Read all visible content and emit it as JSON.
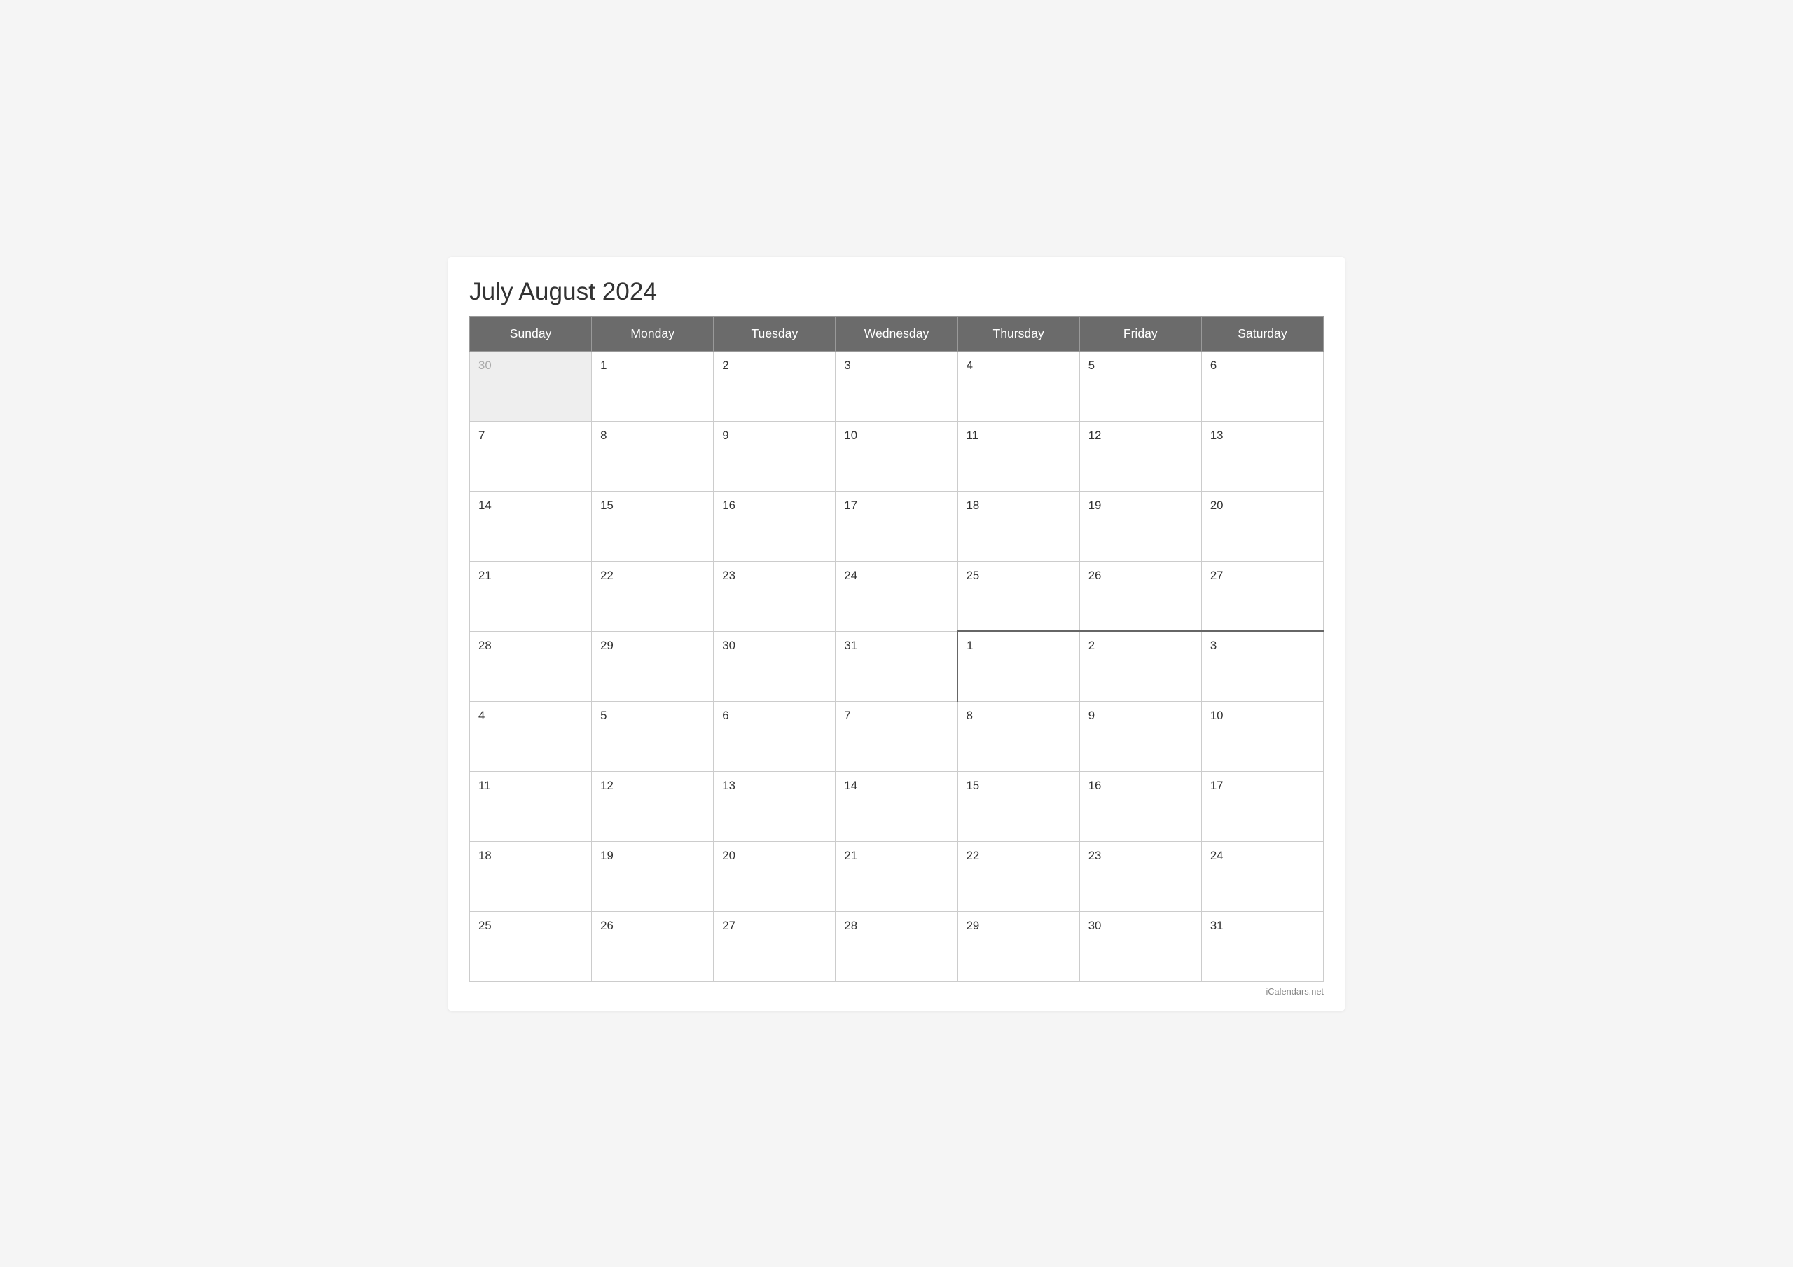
{
  "title": "July August 2024",
  "header": {
    "days": [
      "Sunday",
      "Monday",
      "Tuesday",
      "Wednesday",
      "Thursday",
      "Friday",
      "Saturday"
    ]
  },
  "weeks": [
    {
      "cells": [
        {
          "day": "30",
          "type": "prev-month"
        },
        {
          "day": "1",
          "type": "current"
        },
        {
          "day": "2",
          "type": "current"
        },
        {
          "day": "3",
          "type": "current"
        },
        {
          "day": "4",
          "type": "current"
        },
        {
          "day": "5",
          "type": "current"
        },
        {
          "day": "6",
          "type": "current"
        }
      ]
    },
    {
      "cells": [
        {
          "day": "7",
          "type": "current"
        },
        {
          "day": "8",
          "type": "current"
        },
        {
          "day": "9",
          "type": "current"
        },
        {
          "day": "10",
          "type": "current"
        },
        {
          "day": "11",
          "type": "current"
        },
        {
          "day": "12",
          "type": "current"
        },
        {
          "day": "13",
          "type": "current"
        }
      ]
    },
    {
      "cells": [
        {
          "day": "14",
          "type": "current"
        },
        {
          "day": "15",
          "type": "current"
        },
        {
          "day": "16",
          "type": "current"
        },
        {
          "day": "17",
          "type": "current"
        },
        {
          "day": "18",
          "type": "current"
        },
        {
          "day": "19",
          "type": "current"
        },
        {
          "day": "20",
          "type": "current"
        }
      ]
    },
    {
      "cells": [
        {
          "day": "21",
          "type": "current"
        },
        {
          "day": "22",
          "type": "current"
        },
        {
          "day": "23",
          "type": "current"
        },
        {
          "day": "24",
          "type": "current"
        },
        {
          "day": "25",
          "type": "current"
        },
        {
          "day": "26",
          "type": "current"
        },
        {
          "day": "27",
          "type": "current"
        }
      ]
    },
    {
      "cells": [
        {
          "day": "28",
          "type": "current"
        },
        {
          "day": "29",
          "type": "current"
        },
        {
          "day": "30",
          "type": "current"
        },
        {
          "day": "31",
          "type": "current"
        },
        {
          "day": "1",
          "type": "next-month",
          "boundary": "left-top"
        },
        {
          "day": "2",
          "type": "next-month"
        },
        {
          "day": "3",
          "type": "next-month"
        }
      ]
    },
    {
      "cells": [
        {
          "day": "4",
          "type": "next-month"
        },
        {
          "day": "5",
          "type": "next-month"
        },
        {
          "day": "6",
          "type": "next-month"
        },
        {
          "day": "7",
          "type": "next-month"
        },
        {
          "day": "8",
          "type": "next-month"
        },
        {
          "day": "9",
          "type": "next-month"
        },
        {
          "day": "10",
          "type": "next-month"
        }
      ]
    },
    {
      "cells": [
        {
          "day": "11",
          "type": "next-month"
        },
        {
          "day": "12",
          "type": "next-month"
        },
        {
          "day": "13",
          "type": "next-month"
        },
        {
          "day": "14",
          "type": "next-month"
        },
        {
          "day": "15",
          "type": "next-month"
        },
        {
          "day": "16",
          "type": "next-month"
        },
        {
          "day": "17",
          "type": "next-month"
        }
      ]
    },
    {
      "cells": [
        {
          "day": "18",
          "type": "next-month"
        },
        {
          "day": "19",
          "type": "next-month"
        },
        {
          "day": "20",
          "type": "next-month"
        },
        {
          "day": "21",
          "type": "next-month"
        },
        {
          "day": "22",
          "type": "next-month"
        },
        {
          "day": "23",
          "type": "next-month"
        },
        {
          "day": "24",
          "type": "next-month"
        }
      ]
    },
    {
      "cells": [
        {
          "day": "25",
          "type": "next-month"
        },
        {
          "day": "26",
          "type": "next-month"
        },
        {
          "day": "27",
          "type": "next-month"
        },
        {
          "day": "28",
          "type": "next-month"
        },
        {
          "day": "29",
          "type": "next-month"
        },
        {
          "day": "30",
          "type": "next-month"
        },
        {
          "day": "31",
          "type": "next-month"
        }
      ]
    }
  ],
  "footer": {
    "credit": "iCalendars.net"
  }
}
